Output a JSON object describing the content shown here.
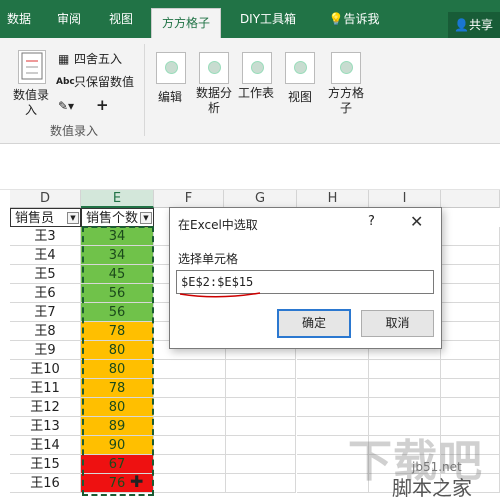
{
  "tabs": [
    "数据",
    "审阅",
    "视图",
    "方方格子",
    "DIY工具箱",
    "告诉我"
  ],
  "share_label": "共享",
  "ribbon": {
    "data_entry_label": "数值录入",
    "round_label": "四舍五入",
    "keep_value_label": "只保留数值",
    "group_label": "数值录入",
    "edit_label": "编辑",
    "analysis_label": "数据分析",
    "worksheet_label": "工作表",
    "view_label": "视图",
    "ffgz_label": "方方格子",
    "abc_label": "Abc",
    "plus_label": "+"
  },
  "columns": [
    "D",
    "E",
    "F",
    "G",
    "H",
    "I"
  ],
  "header_row": {
    "d": "销售员",
    "e": "销售个数"
  },
  "rows": [
    {
      "name": "王3",
      "value": "34",
      "color": "#70c24a"
    },
    {
      "name": "王4",
      "value": "34",
      "color": "#70c24a"
    },
    {
      "name": "王5",
      "value": "45",
      "color": "#70c24a"
    },
    {
      "name": "王6",
      "value": "56",
      "color": "#70c24a"
    },
    {
      "name": "王7",
      "value": "56",
      "color": "#70c24a"
    },
    {
      "name": "王8",
      "value": "78",
      "color": "#ffbf00"
    },
    {
      "name": "王9",
      "value": "80",
      "color": "#ffbf00"
    },
    {
      "name": "王10",
      "value": "80",
      "color": "#ffbf00"
    },
    {
      "name": "王11",
      "value": "78",
      "color": "#ffbf00"
    },
    {
      "name": "王12",
      "value": "80",
      "color": "#ffbf00"
    },
    {
      "name": "王13",
      "value": "89",
      "color": "#ffbf00"
    },
    {
      "name": "王14",
      "value": "90",
      "color": "#ffbf00"
    },
    {
      "name": "王15",
      "value": "67",
      "color": "#ee1111"
    },
    {
      "name": "王16",
      "value": "76",
      "color": "#ee1111"
    }
  ],
  "dialog": {
    "title": "在Excel中选取",
    "help": "?",
    "close": "✕",
    "label": "选择单元格",
    "input_value": "$E$2:$E$15",
    "ok": "确定",
    "cancel": "取消"
  },
  "watermark": {
    "main": "下载吧",
    "url": "jb51.net",
    "site": "脚本之家"
  }
}
